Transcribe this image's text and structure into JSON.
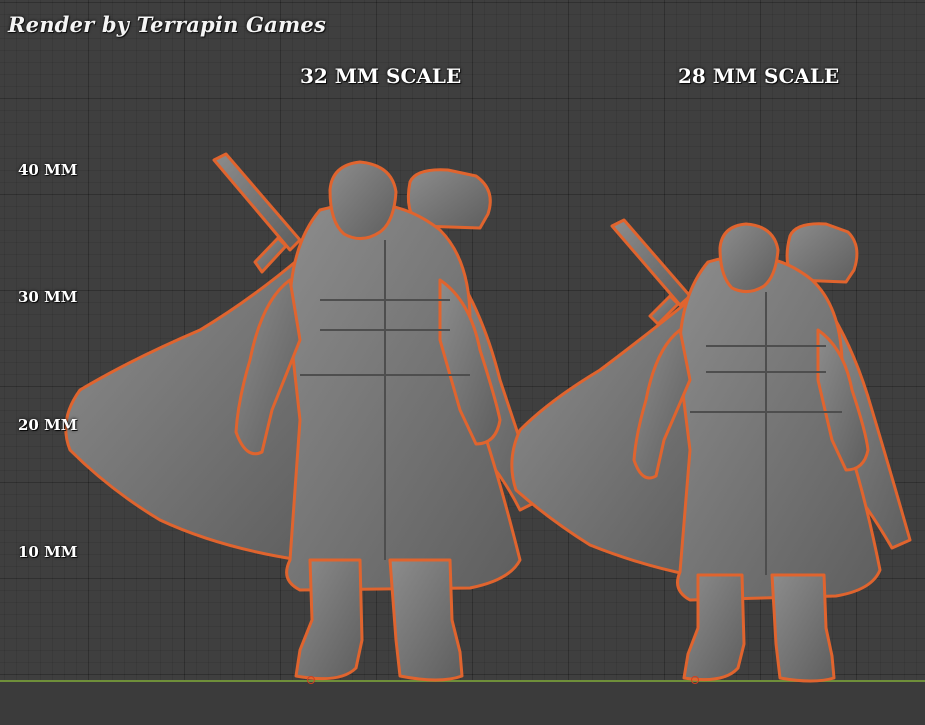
{
  "credit": "Render by Terrapin Games",
  "scales": [
    {
      "label": "32 MM SCALE"
    },
    {
      "label": "28 MM SCALE"
    }
  ],
  "ruler": {
    "labels": [
      "40 MM",
      "30 MM",
      "20 MM",
      "10 MM"
    ]
  },
  "colors": {
    "background": "#3f3f3f",
    "model": "#7a7a7a",
    "outline": "#e0642e",
    "ground_line": "#6f8f3a",
    "text": "#ffffff"
  }
}
